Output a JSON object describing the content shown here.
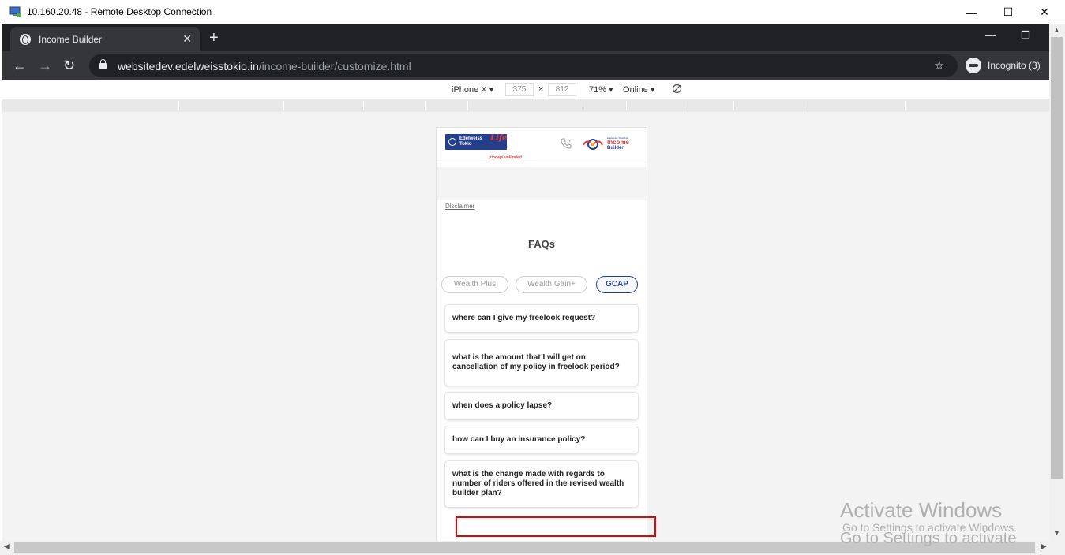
{
  "rdp": {
    "title": "10.160.20.48 - Remote Desktop Connection",
    "minimize": "—",
    "maximize": "☐",
    "close": "✕"
  },
  "chrome": {
    "tab_title": "Income Builder",
    "tab_close": "✕",
    "new_tab": "+",
    "url_host": "websitedev.edelweisstokio.in",
    "url_path": "/income-builder/customize.html",
    "incognito_label": "Incognito (3)",
    "win_min": "—",
    "win_restore": "❐",
    "back": "←",
    "forward": "→",
    "reload": "↻",
    "star": "☆"
  },
  "devtools": {
    "device": "iPhone X",
    "width": "375",
    "height": "812",
    "times": "×",
    "zoom": "71%",
    "network": "Online"
  },
  "page": {
    "logo_brand_line1": "Edelweiss",
    "logo_brand_line2": "Tokio",
    "logo_life": "Life",
    "logo_tagline": "zindagi unlimited",
    "logo2_small": "Edelweiss Tokio Life",
    "logo2_income": "Income",
    "logo2_builder": "Builder",
    "disclaimer": "Disclaimer",
    "faq_title": "FAQs",
    "tabs": [
      {
        "label": "Wealth Plus",
        "active": false
      },
      {
        "label": "Wealth Gain+",
        "active": false
      },
      {
        "label": "GCAP",
        "active": true
      }
    ],
    "questions": [
      "where can I give my freelook request?",
      "what is the amount that I will get on cancellation of my policy in freelook period?",
      "when does a policy lapse?",
      "how can I buy an insurance policy?",
      "what is the change made with regards to number of riders offered in the revised wealth builder plan?"
    ]
  },
  "watermark": {
    "line1": "Activate Windows",
    "line2": "Go to Settings to activate Windows.",
    "line3": "Go to Settings to activate"
  },
  "colors": {
    "brand_blue": "#243e8c",
    "brand_red": "#e23e3e",
    "highlight_red": "#ee0000",
    "chrome_dark": "#202124"
  }
}
